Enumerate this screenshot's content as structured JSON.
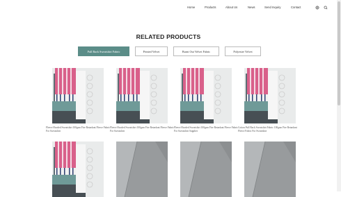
{
  "nav": {
    "items": [
      "Home",
      "Products",
      "About Us",
      "News",
      "Send Inquiry",
      "Contact"
    ],
    "icons": [
      "globe-icon",
      "search-icon"
    ]
  },
  "page_title": "RELATED PRODUCTS",
  "categories": [
    {
      "label": "Pull Back Sweatshirt Fabric",
      "active": true
    },
    {
      "label": "Printed Velvet",
      "active": false
    },
    {
      "label": "Burnt Out Velvet Fabric",
      "active": false
    },
    {
      "label": "Polyester Velvet",
      "active": false
    }
  ],
  "products": [
    {
      "caption": "Fleece Hooded Sweatshirt 100gsm Fire Retardant Fleece Fabric For Sweatshirt",
      "image": "striped-fabric-swatches"
    },
    {
      "caption": "Fleece Hooded Sweatshirt 100gsm Fire Retardant Fleece Fabric For Sweatshirt",
      "image": "striped-fabric-swatches"
    },
    {
      "caption": "Fleece Hooded Sweatshirt 100gsm Fire Retardant Fleece Fabric For Sweatshirt Supplier",
      "image": "striped-fabric-swatches"
    },
    {
      "caption": "Cotton Pull Back Sweatshirt Fabric 100gsm Fire Retardant Fleece Fabric For Sweatshirt",
      "image": "striped-fabric-swatches"
    },
    {
      "caption": "",
      "image": "striped-fabric-swatches"
    },
    {
      "caption": "",
      "image": "grey-fleece-fabric"
    },
    {
      "caption": "",
      "image": "grey-fleece-fabric"
    },
    {
      "caption": "",
      "image": "grey-fleece-fabric"
    }
  ],
  "colors": {
    "accent": "#5b8d88",
    "pink_stripe": "#d9608a",
    "teal_fabric": "#6f9a98",
    "grey_fabric": "#a3a6a8"
  }
}
